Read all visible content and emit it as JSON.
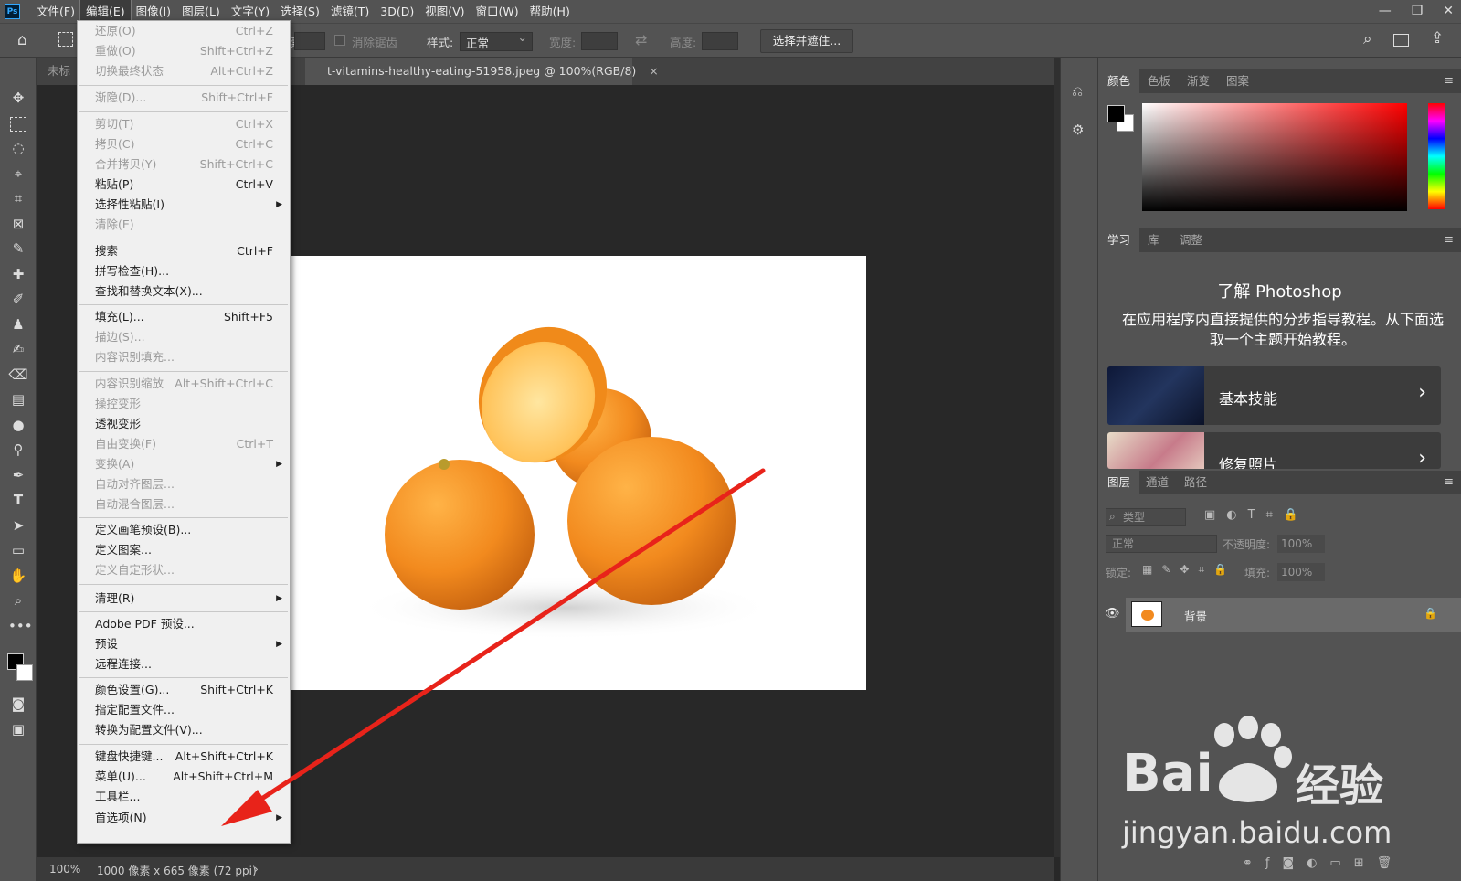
{
  "menubar": {
    "logo": "Ps",
    "items": [
      "文件(F)",
      "编辑(E)",
      "图像(I)",
      "图层(L)",
      "文字(Y)",
      "选择(S)",
      "滤镜(T)",
      "3D(D)",
      "视图(V)",
      "窗口(W)",
      "帮助(H)"
    ],
    "active_index": 1,
    "window_controls": [
      "—",
      "❐",
      "✕"
    ]
  },
  "options": {
    "feather_suffix": "素",
    "antialias": "消除锯齿",
    "style_label": "样式:",
    "style_value": "正常",
    "width_label": "宽度:",
    "height_label": "高度:",
    "select_mask_button": "选择并遮住..."
  },
  "tabs": {
    "inactive": "未标",
    "active": "t-vitamins-healthy-eating-51958.jpeg @ 100%(RGB/8)",
    "close": "×"
  },
  "status": {
    "zoom": "100%",
    "info": "1000 像素 x 665 像素 (72 ppi)",
    "more": "›"
  },
  "edit_menu": {
    "items": [
      {
        "label": "还原(O)",
        "shortcut": "Ctrl+Z",
        "disabled": true
      },
      {
        "label": "重做(O)",
        "shortcut": "Shift+Ctrl+Z",
        "disabled": true
      },
      {
        "label": "切换最终状态",
        "shortcut": "Alt+Ctrl+Z",
        "disabled": true
      },
      {
        "label": "渐隐(D)...",
        "shortcut": "Shift+Ctrl+F",
        "disabled": true
      },
      {
        "label": "剪切(T)",
        "shortcut": "Ctrl+X",
        "disabled": true
      },
      {
        "label": "拷贝(C)",
        "shortcut": "Ctrl+C",
        "disabled": true
      },
      {
        "label": "合并拷贝(Y)",
        "shortcut": "Shift+Ctrl+C",
        "disabled": true
      },
      {
        "label": "粘贴(P)",
        "shortcut": "Ctrl+V",
        "disabled": false
      },
      {
        "label": "选择性粘贴(I)",
        "shortcut": "",
        "disabled": false,
        "submenu": true
      },
      {
        "label": "清除(E)",
        "shortcut": "",
        "disabled": true
      },
      {
        "label": "搜索",
        "shortcut": "Ctrl+F",
        "disabled": false
      },
      {
        "label": "拼写检查(H)...",
        "shortcut": "",
        "disabled": false
      },
      {
        "label": "查找和替换文本(X)...",
        "shortcut": "",
        "disabled": false
      },
      {
        "label": "填充(L)...",
        "shortcut": "Shift+F5",
        "disabled": false
      },
      {
        "label": "描边(S)...",
        "shortcut": "",
        "disabled": true
      },
      {
        "label": "内容识别填充...",
        "shortcut": "",
        "disabled": true
      },
      {
        "label": "内容识别缩放",
        "shortcut": "Alt+Shift+Ctrl+C",
        "disabled": true
      },
      {
        "label": "操控变形",
        "shortcut": "",
        "disabled": true
      },
      {
        "label": "透视变形",
        "shortcut": "",
        "disabled": false
      },
      {
        "label": "自由变换(F)",
        "shortcut": "Ctrl+T",
        "disabled": true
      },
      {
        "label": "变换(A)",
        "shortcut": "",
        "disabled": true,
        "submenu": true
      },
      {
        "label": "自动对齐图层...",
        "shortcut": "",
        "disabled": true
      },
      {
        "label": "自动混合图层...",
        "shortcut": "",
        "disabled": true
      },
      {
        "label": "定义画笔预设(B)...",
        "shortcut": "",
        "disabled": false
      },
      {
        "label": "定义图案...",
        "shortcut": "",
        "disabled": false
      },
      {
        "label": "定义自定形状...",
        "shortcut": "",
        "disabled": true
      },
      {
        "label": "清理(R)",
        "shortcut": "",
        "disabled": false,
        "submenu": true
      },
      {
        "label": "Adobe PDF 预设...",
        "shortcut": "",
        "disabled": false
      },
      {
        "label": "预设",
        "shortcut": "",
        "disabled": false,
        "submenu": true
      },
      {
        "label": "远程连接...",
        "shortcut": "",
        "disabled": false
      },
      {
        "label": "颜色设置(G)...",
        "shortcut": "Shift+Ctrl+K",
        "disabled": false
      },
      {
        "label": "指定配置文件...",
        "shortcut": "",
        "disabled": false
      },
      {
        "label": "转换为配置文件(V)...",
        "shortcut": "",
        "disabled": false
      },
      {
        "label": "键盘快捷键...",
        "shortcut": "Alt+Shift+Ctrl+K",
        "disabled": false
      },
      {
        "label": "菜单(U)...",
        "shortcut": "Alt+Shift+Ctrl+M",
        "disabled": false
      },
      {
        "label": "工具栏...",
        "shortcut": "",
        "disabled": false
      },
      {
        "label": "首选项(N)",
        "shortcut": "",
        "disabled": false,
        "submenu": true
      }
    ]
  },
  "color_panel": {
    "tabs": [
      "颜色",
      "色板",
      "渐变",
      "图案"
    ],
    "foreground": "#000000",
    "background": "#ffffff"
  },
  "learn_panel": {
    "tabs": [
      "学习",
      "库",
      "调整"
    ],
    "title": "了解 Photoshop",
    "description": "在应用程序内直接提供的分步指导教程。从下面选取一个主题开始教程。",
    "cards": [
      {
        "title": "基本技能"
      },
      {
        "title": "修复照片"
      }
    ]
  },
  "layers_panel": {
    "tabs": [
      "图层",
      "通道",
      "路径"
    ],
    "filter_placeholder": "类型",
    "blend_mode": "正常",
    "opacity_label": "不透明度:",
    "opacity_value": "100%",
    "lock_label": "锁定:",
    "fill_label": "填充:",
    "fill_value": "100%",
    "layer_name": "背景"
  },
  "watermark": {
    "brand": "Bai",
    "logo_text": "经验",
    "url": "jingyan.baidu.com"
  },
  "colors": {
    "annotation_arrow": "#e8231a",
    "orange": "#f28a1e",
    "ui_dark": "#535353"
  }
}
